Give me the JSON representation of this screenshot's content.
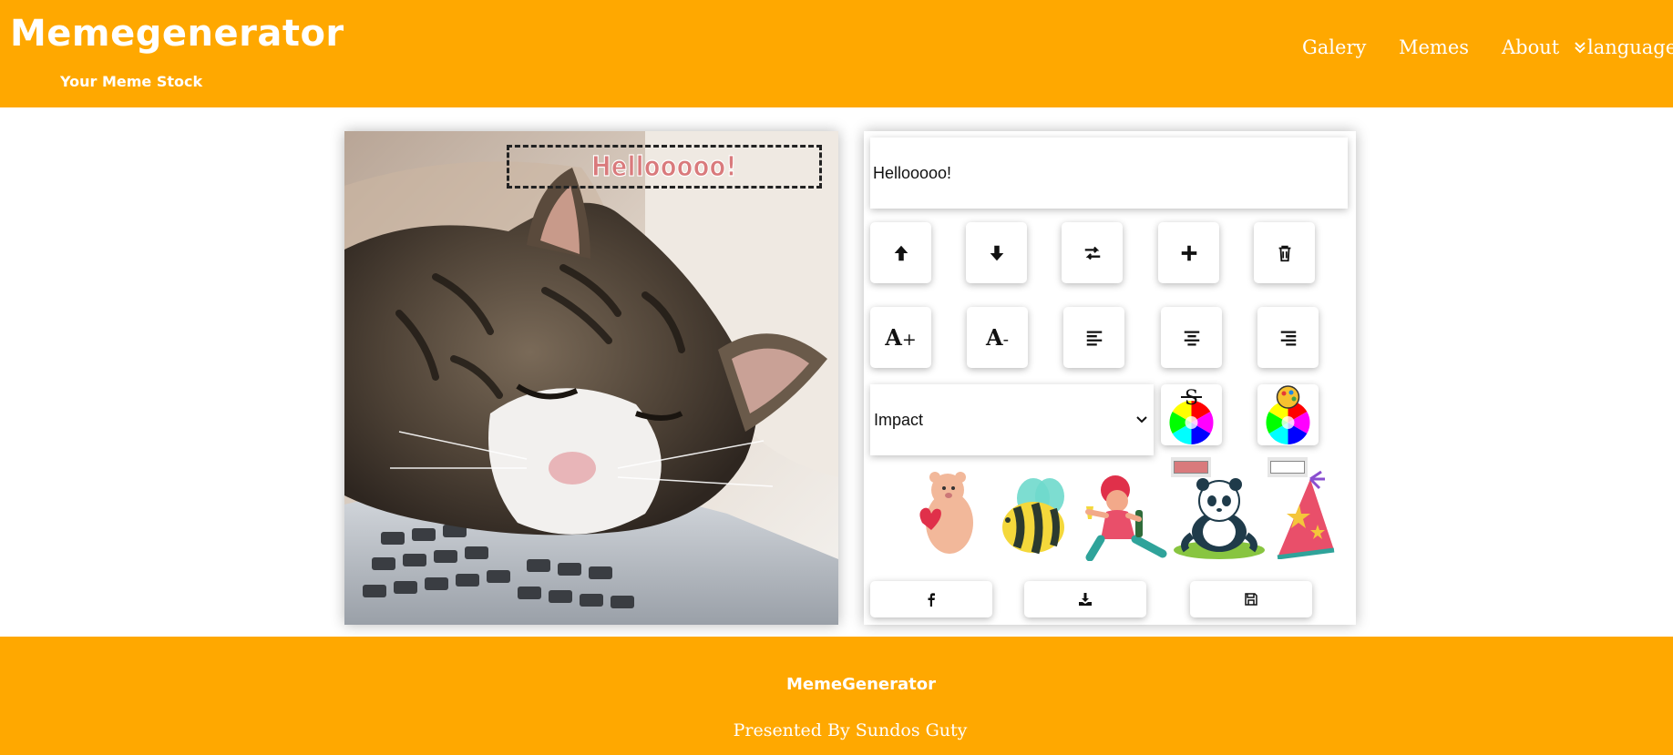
{
  "header": {
    "title": "Memegenerator",
    "subtitle": "Your Meme Stock",
    "nav": [
      "Galery",
      "Memes",
      "About"
    ],
    "language_label": "language"
  },
  "meme": {
    "line_text": "Hellooooo!",
    "text_color": "#d97a7c",
    "stroke_color": "#ffffff"
  },
  "editor": {
    "text_input_value": "Hellooooo!",
    "line_buttons": [
      "arrow-up-icon",
      "arrow-down-icon",
      "swap-lines-icon",
      "plus-icon",
      "trash-icon"
    ],
    "font_buttons": {
      "increase_label": "A",
      "increase_suffix": "+",
      "decrease_label": "A",
      "decrease_suffix": "-"
    },
    "font_family": "Impact",
    "stroke_color": "#d97a7c",
    "fill_color": "#ffffff",
    "stickers": [
      "bear-with-heart-sticker",
      "bee-sticker",
      "party-girl-sticker",
      "panda-sticker",
      "party-hat-sticker"
    ]
  },
  "footer": {
    "title": "MemeGenerator",
    "credit": "Presented By Sundos Guty"
  },
  "colors": {
    "brand": "#ffa800"
  }
}
